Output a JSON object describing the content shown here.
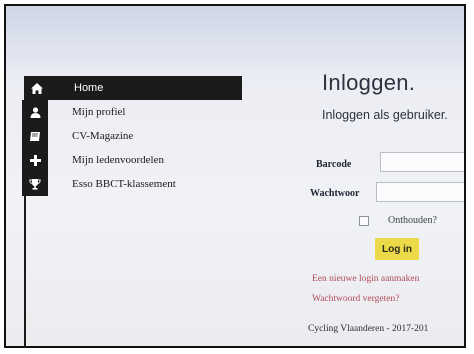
{
  "sidebar": {
    "items": [
      {
        "label": "Home",
        "icon": "home-icon",
        "active": true
      },
      {
        "label": "Mijn profiel",
        "icon": "user-icon",
        "active": false
      },
      {
        "label": "CV-Magazine",
        "icon": "book-icon",
        "active": false
      },
      {
        "label": "Mijn ledenvoordelen",
        "icon": "plus-icon",
        "active": false
      },
      {
        "label": "Esso BBCT-klassement",
        "icon": "trophy-icon",
        "active": false
      }
    ]
  },
  "login": {
    "title": "Inloggen.",
    "subtitle": "Inloggen als gebruiker.",
    "barcode_label": "Barcode",
    "barcode_value": "",
    "password_label": "Wachtwoor",
    "password_value": "",
    "remember_label": "Onthouden?",
    "remember_checked": false,
    "login_button": "Log in",
    "new_login_link": "Een nieuwe login aanmaken",
    "forgot_password_link": "Wachtwoord vergeten?"
  },
  "footer": {
    "text": "Cycling Vlaanderen - 2017-201"
  },
  "colors": {
    "sidebar_active_bg": "#1b1b1b",
    "button_bg": "#ecd94a",
    "link": "#b04a5a"
  }
}
